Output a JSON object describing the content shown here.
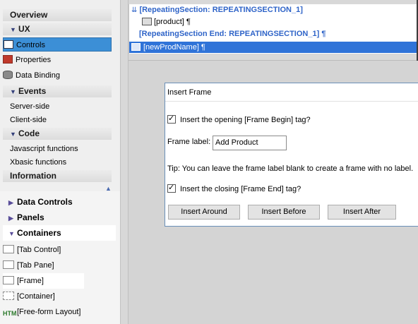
{
  "left_panel": {
    "sections": [
      {
        "label": "Overview"
      },
      {
        "label": "UX"
      },
      {
        "label": "Events"
      },
      {
        "label": "Code"
      },
      {
        "label": "Information"
      }
    ],
    "ux_items": [
      {
        "label": "Controls",
        "icon": "controls-icon",
        "selected": true
      },
      {
        "label": "Properties",
        "icon": "properties-icon"
      },
      {
        "label": "Data Binding",
        "icon": "database-icon"
      }
    ],
    "events_items": [
      {
        "label": "Server-side"
      },
      {
        "label": "Client-side"
      }
    ],
    "code_items": [
      {
        "label": "Javascript functions"
      },
      {
        "label": "Xbasic functions"
      }
    ]
  },
  "controls_panel": {
    "sections": [
      {
        "label": "Data Controls",
        "expanded": false
      },
      {
        "label": "Panels",
        "expanded": false
      },
      {
        "label": "Containers",
        "expanded": true
      }
    ],
    "containers": [
      {
        "label": "[Tab Control]",
        "icon": "tab-control-icon"
      },
      {
        "label": "[Tab Pane]",
        "icon": "tab-pane-icon"
      },
      {
        "label": "[Frame]",
        "icon": "frame-icon",
        "highlighted": true
      },
      {
        "label": "[Container]",
        "icon": "container-icon"
      },
      {
        "label": "[Free-form Layout]",
        "icon": "freeform-icon"
      }
    ]
  },
  "editor": {
    "lines": [
      {
        "text": "[RepeatingSection: REPEATINGSECTION_1]"
      },
      {
        "text": "[product] ¶"
      },
      {
        "text": "[RepeatingSection End: REPEATINGSECTION_1] ¶"
      },
      {
        "text": "[newProdName] ¶",
        "selected": true
      }
    ]
  },
  "dialog": {
    "title": "Insert Frame",
    "open_checkbox_label": "Insert the opening [Frame Begin] tag?",
    "open_checked": true,
    "frame_label_caption": "Frame label:",
    "frame_label_value": "Add Product",
    "tip": "Tip: You can leave the frame label blank to create a frame with no label.",
    "close_checkbox_label": "Insert the closing [Frame End] tag?",
    "close_checked": true,
    "buttons": {
      "around": "Insert Around",
      "before": "Insert Before",
      "after": "Insert After"
    }
  },
  "colors": {
    "selection": "#3c8fd6",
    "editor_blue": "#2f64c8"
  }
}
